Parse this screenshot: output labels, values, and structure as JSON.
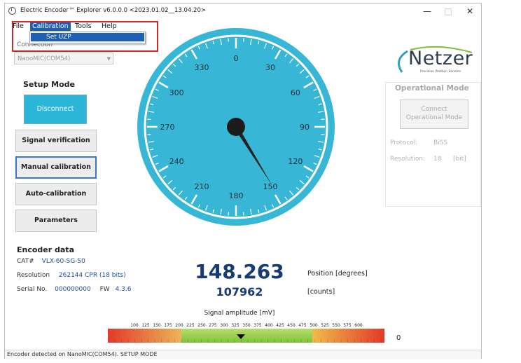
{
  "window": {
    "title": "Electric Encoder™ Explorer v6.0.0.0  <2023.01.02__13.04.20>",
    "minimize": "—",
    "maximize": "□",
    "close": "✕"
  },
  "menu": {
    "file": "File",
    "calibration": "Calibration",
    "tools": "Tools",
    "help": "Help",
    "calibration_dropdown": [
      "Set UZP"
    ]
  },
  "connection": {
    "label": "Connection",
    "selected": "NanoMIC(COM54)"
  },
  "setup": {
    "title": "Setup Mode",
    "disconnect": "Disconnect",
    "signal_verification": "Signal verification",
    "manual_calibration": "Manual calibration",
    "auto_calibration": "Auto-calibration",
    "parameters": "Parameters"
  },
  "encoder": {
    "title": "Encoder data",
    "cat_label": "CAT#",
    "cat_value": "VLX-60-SG-S0",
    "resolution_label": "Resolution",
    "resolution_value": "262144 CPR (18 bits)",
    "serial_label": "Serial No.",
    "serial_value": "000000000",
    "fw_label": "FW",
    "fw_value": "4.3.6"
  },
  "gauge": {
    "tick_labels": [
      "0",
      "30",
      "60",
      "90",
      "120",
      "150",
      "180",
      "210",
      "240",
      "270",
      "300",
      "330"
    ],
    "needle_degrees": 148.263,
    "face_color": "#37b6d6",
    "rim_color": "#37b6d6"
  },
  "position": {
    "degrees": "148.263",
    "counts": "107962",
    "degrees_label": "Position [degrees]",
    "counts_label": "[counts]"
  },
  "amplitude": {
    "title": "Signal amplitude [mV]",
    "scale_labels": [
      "100",
      "125",
      "150",
      "175",
      "200",
      "225",
      "250",
      "275",
      "300",
      "325",
      "350",
      "375",
      "400",
      "425",
      "450",
      "475",
      "500",
      "525",
      "550",
      "575",
      "600"
    ],
    "value": "0",
    "marker_mv": 350
  },
  "logo": {
    "name": "Netzer",
    "tagline": "Precision Position Sensors"
  },
  "operational": {
    "title": "Operational Mode",
    "connect_line1": "Connect",
    "connect_line2": "Operational Mode",
    "protocol_label": "Protocol:",
    "protocol_value": "BiSS",
    "resolution_label": "Resolution:",
    "resolution_value": "18",
    "resolution_unit": "[bit]"
  },
  "status": {
    "text": "Encoder detected on NanoMIC(COM54). SETUP MODE"
  }
}
